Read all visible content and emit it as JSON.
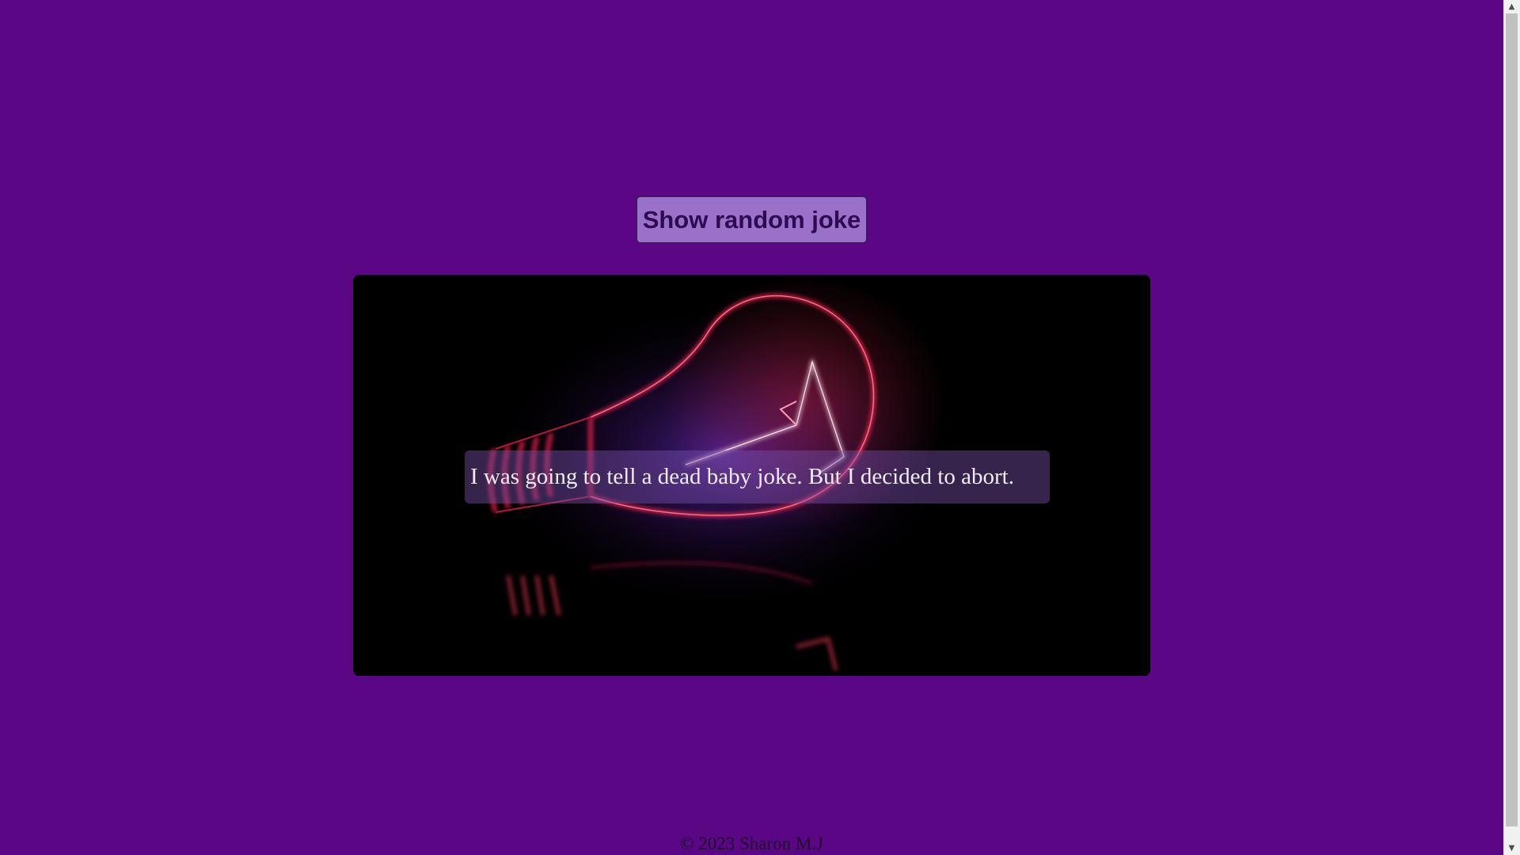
{
  "button": {
    "label": "Show random joke"
  },
  "joke": {
    "text": "I was going to tell a dead baby joke. But I decided to abort."
  },
  "image": {
    "subject": "glowing-lightbulb"
  },
  "footer": {
    "text": "© 2023 Sharon M.J"
  },
  "colors": {
    "background": "#5b0785",
    "button": "#9a71c8",
    "button_text": "#2d0a52",
    "bulb_glow": "#ff2a55"
  },
  "icons": {
    "scroll_up": "triangle-up-icon",
    "scroll_down": "triangle-down-icon"
  }
}
